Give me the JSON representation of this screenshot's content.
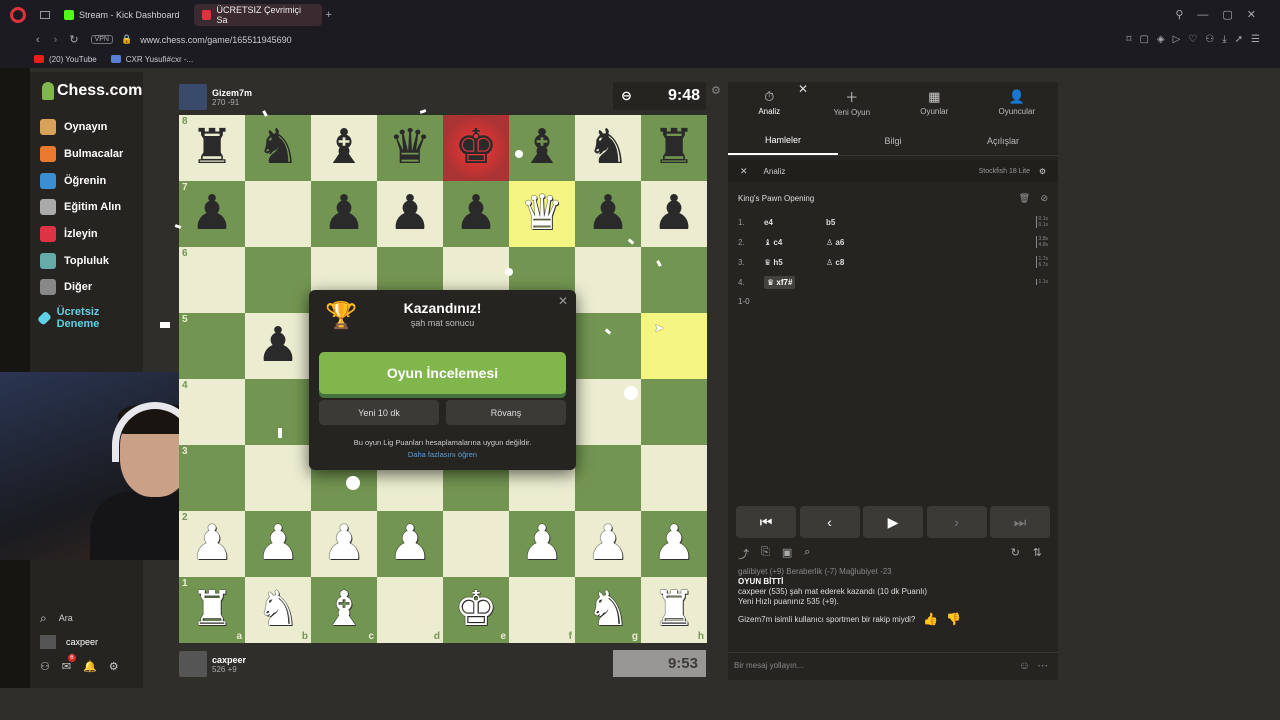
{
  "browser": {
    "tabs": [
      {
        "label": "Stream - Kick Dashboard",
        "active": false,
        "color": "#53fc18"
      },
      {
        "label": "ÜCRETSIZ Çevrimiçi Sa",
        "active": true,
        "color": "#e0313c"
      }
    ],
    "vpn": "VPN",
    "url": "www.chess.com/game/165511945690",
    "bookmarks": [
      {
        "label": "(20) YouTube"
      },
      {
        "label": "CXR Yusufi#cxr -..."
      }
    ]
  },
  "sidebar": {
    "logo": "Chess.com",
    "items": [
      {
        "label": "Oynayın",
        "color": "#d9a25b"
      },
      {
        "label": "Bulmacalar",
        "color": "#e97a2f"
      },
      {
        "label": "Öğrenin",
        "color": "#3a8fd1"
      },
      {
        "label": "Eğitim Alın",
        "color": "#aaa"
      },
      {
        "label": "İzleyin",
        "color": "#d34"
      },
      {
        "label": "Topluluk",
        "color": "#6aa"
      },
      {
        "label": "Diğer",
        "color": "#888"
      },
      {
        "label": "Ücretsiz Deneme",
        "color": "#5fd0e6"
      }
    ],
    "search_label": "Ara",
    "user": "caxpeer",
    "notification_count": "6"
  },
  "top_player": {
    "name": "Gizem7m",
    "rating": "270",
    "delta": "-91",
    "clock": "9:48"
  },
  "bottom_player": {
    "name": "caxpeer",
    "rating": "526",
    "delta": "+9",
    "clock": "9:53"
  },
  "board": {
    "ranks": [
      "8",
      "7",
      "6",
      "5",
      "4",
      "3",
      "2",
      "1"
    ],
    "files": [
      "a",
      "b",
      "c",
      "d",
      "e",
      "f",
      "g",
      "h"
    ],
    "rows": [
      [
        "br",
        "bn",
        "bb",
        "bq",
        "bk",
        "bb",
        "bn",
        "br"
      ],
      [
        "bp",
        "",
        "bp",
        "bp",
        "bp",
        "wq",
        "bp",
        "bp"
      ],
      [
        "",
        "",
        "",
        "",
        "",
        "",
        "",
        ""
      ],
      [
        "",
        "bp",
        "",
        "",
        "",
        "",
        "",
        ""
      ],
      [
        "",
        "",
        "",
        "",
        "",
        "",
        "",
        ""
      ],
      [
        "",
        "",
        "",
        "",
        "",
        "",
        "",
        ""
      ],
      [
        "wp",
        "wp",
        "wp",
        "wp",
        "",
        "wp",
        "wp",
        "wp"
      ],
      [
        "wr",
        "wn",
        "wb",
        "",
        "wk",
        "",
        "wn",
        "wr"
      ]
    ],
    "highlights": [
      "f7",
      "h5"
    ],
    "check_square": "e8"
  },
  "modal": {
    "title": "Kazandınız!",
    "subtitle": "şah mat sonucu",
    "review_button": "Oyun İncelemesi",
    "new_game_button": "Yeni 10 dk",
    "rematch_button": "Rövanş",
    "note": "Bu oyun Lig Puanları hesaplamalarına uygun değildir.",
    "learn_more": "Daha fazlasını öğren"
  },
  "panel": {
    "tabs": [
      {
        "label": "Analiz",
        "icon": "⏱"
      },
      {
        "label": "Yeni Oyun",
        "icon": "＋"
      },
      {
        "label": "Oyunlar",
        "icon": "▦"
      },
      {
        "label": "Oyuncular",
        "icon": "👤"
      }
    ],
    "subtabs": [
      "Hamleler",
      "Bilgi",
      "Açılışlar"
    ],
    "analysis_label": "Analiz",
    "engine": "Stockfish 18 Lite",
    "opening": "King's Pawn Opening",
    "moves": [
      {
        "num": "1.",
        "white": "e4",
        "black": "b5",
        "t1": "0.1s",
        "t2": "0.1s"
      },
      {
        "num": "2.",
        "white": "♝ c4",
        "black": "♙ a6",
        "t1": "3.8s",
        "t2": "4.8s"
      },
      {
        "num": "3.",
        "white": "♛ h5",
        "black": "♙ c8",
        "t1": "1.7s",
        "t2": "6.7s"
      },
      {
        "num": "4.",
        "white": "♛ xf7#",
        "black": "",
        "t1": "1.1s",
        "t2": ""
      }
    ],
    "result": "1-0",
    "chat": [
      "galibiyet (+9) Beraberlik (-7) Mağlubiyet -23",
      "OYUN BİTTİ",
      "caxpeer (535) şah mat ederek kazandı (10 dk Puanlı)",
      "Yeni Hızlı puanınız 535 (+9).",
      "Gizem7m isimli kullanıcı sportmen bir rakip miydi?"
    ],
    "chat_placeholder": "Bir mesaj yollayın..."
  }
}
